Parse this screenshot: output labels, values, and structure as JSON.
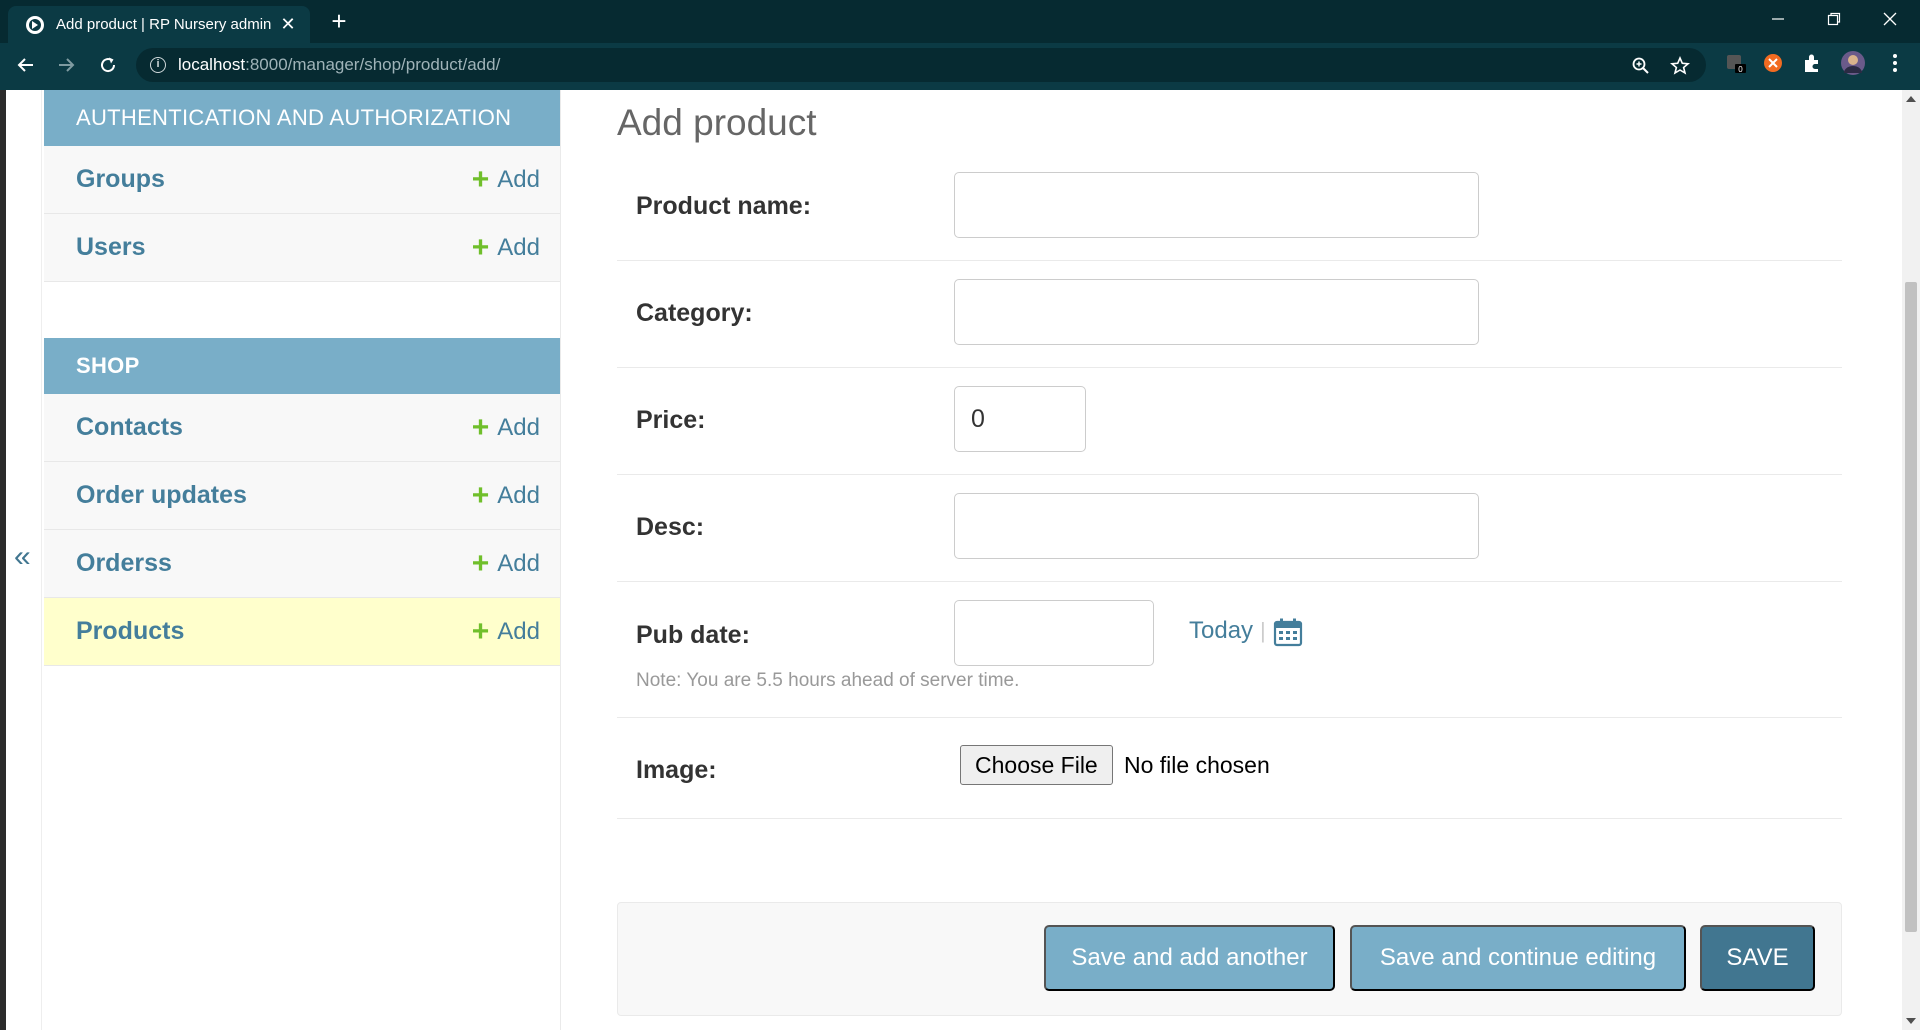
{
  "browser": {
    "tab_title": "Add product | RP Nursery admin",
    "url_host": "localhost",
    "url_path": ":8000/manager/shop/product/add/"
  },
  "sidebar": {
    "toggle_glyph": "«",
    "modules": [
      {
        "caption": "AUTHENTICATION AND AUTHORIZATION",
        "items": [
          {
            "name": "Groups",
            "add": "Add"
          },
          {
            "name": "Users",
            "add": "Add"
          }
        ]
      },
      {
        "caption": "SHOP",
        "items": [
          {
            "name": "Contacts",
            "add": "Add"
          },
          {
            "name": "Order updates",
            "add": "Add"
          },
          {
            "name": "Orderss",
            "add": "Add"
          },
          {
            "name": "Products",
            "add": "Add"
          }
        ]
      }
    ]
  },
  "main": {
    "title": "Add product",
    "fields": {
      "product_name": {
        "label": "Product name:",
        "value": ""
      },
      "category": {
        "label": "Category:",
        "value": ""
      },
      "price": {
        "label": "Price:",
        "value": "0"
      },
      "desc": {
        "label": "Desc:",
        "value": ""
      },
      "pub_date": {
        "label": "Pub date:",
        "value": "",
        "today_link": "Today",
        "separator": "|",
        "help": "Note: You are 5.5 hours ahead of server time."
      },
      "image": {
        "label": "Image:",
        "button": "Choose File",
        "status": "No file chosen"
      }
    },
    "submit": {
      "save_add_another": "Save and add another",
      "save_continue": "Save and continue editing",
      "save": "SAVE"
    }
  },
  "colors": {
    "header_blue": "#79aec8",
    "link_blue": "#447e9b",
    "add_green": "#70bf2b",
    "default_button": "#417690",
    "selected_row": "#ffffcc"
  }
}
